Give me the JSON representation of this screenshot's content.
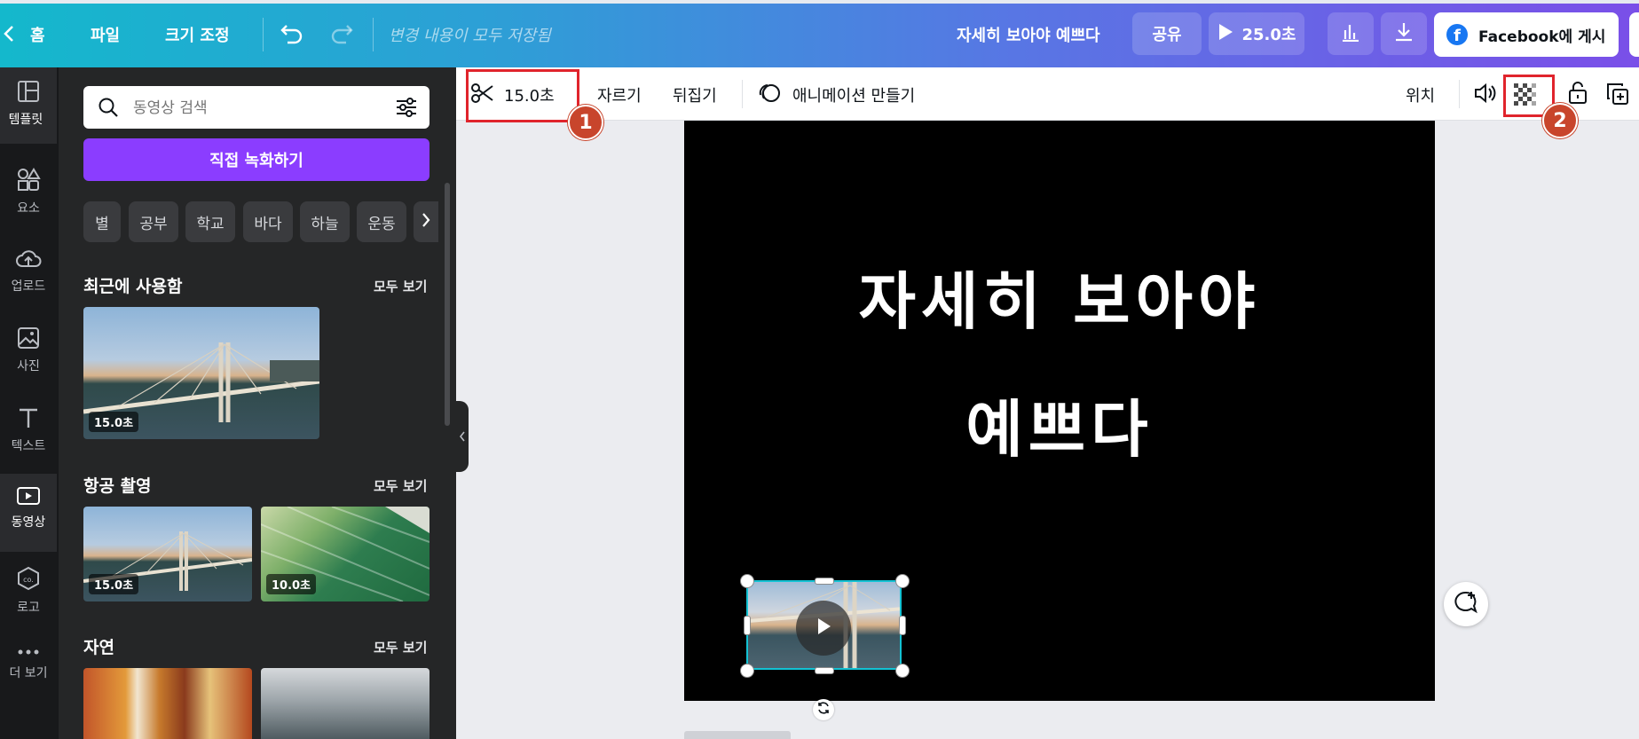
{
  "topbar": {
    "back_icon": "chevron-left-icon",
    "home": "홈",
    "file": "파일",
    "resize": "크기 조정",
    "status": "변경 내용이 모두 저장됨",
    "design_title": "자세히 보아야 예쁘다",
    "share": "공유",
    "play_duration": "25.0초",
    "facebook_post": "Facebook에 게시"
  },
  "rail": {
    "items": [
      {
        "label": "템플릿",
        "icon": "template-icon"
      },
      {
        "label": "요소",
        "icon": "elements-icon"
      },
      {
        "label": "업로드",
        "icon": "upload-icon"
      },
      {
        "label": "사진",
        "icon": "photo-icon"
      },
      {
        "label": "텍스트",
        "icon": "text-icon"
      },
      {
        "label": "동영상",
        "icon": "video-icon"
      },
      {
        "label": "로고",
        "icon": "logo-icon"
      },
      {
        "label": "더 보기",
        "icon": "more-icon"
      }
    ]
  },
  "panel": {
    "search_placeholder": "동영상 검색",
    "record_button": "직접 녹화하기",
    "chips": [
      "별",
      "공부",
      "학교",
      "바다",
      "하늘",
      "운동"
    ],
    "sections": [
      {
        "title": "최근에 사용함",
        "see_all": "모두 보기",
        "durations": [
          "15.0초"
        ]
      },
      {
        "title": "항공 촬영",
        "see_all": "모두 보기",
        "durations": [
          "15.0초",
          "10.0초"
        ]
      },
      {
        "title": "자연",
        "see_all": "모두 보기",
        "durations": []
      }
    ]
  },
  "toolbar": {
    "clip_duration": "15.0초",
    "crop": "자르기",
    "flip": "뒤집기",
    "animate": "애니메이션 만들기",
    "position": "위치",
    "badge1": "1",
    "badge2": "2"
  },
  "canvas": {
    "line1": "자세히 보아야",
    "line2": "예쁘다"
  },
  "colors": {
    "accent_purple": "#8b3dff",
    "annotation_red": "#e0242c",
    "selection_teal": "#13c2d3"
  }
}
